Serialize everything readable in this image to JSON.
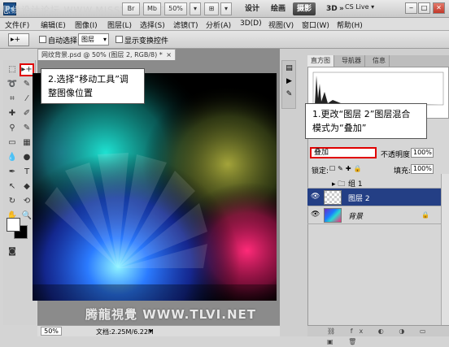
{
  "titlebar": {
    "watermark": "思缘设计论坛 WWW.MISSYUAN.COM",
    "app_logo": "Ps",
    "buttons": [
      "Br",
      "Mb",
      "50%",
      "▾",
      "⊞",
      "▾"
    ],
    "workspaces": [
      {
        "label": "设计",
        "active": false
      },
      {
        "label": "绘画",
        "active": false
      },
      {
        "label": "摄影",
        "active": true
      },
      {
        "label": "3D",
        "active": false
      },
      {
        "label": "»",
        "active": false
      }
    ],
    "cs_live": "CS Live ▾",
    "window_controls": [
      "‒",
      "□",
      "✕"
    ]
  },
  "menubar": [
    "文件(F)",
    "编辑(E)",
    "图像(I)",
    "图层(L)",
    "选择(S)",
    "滤镜(T)",
    "分析(A)",
    "3D(D)",
    "视图(V)",
    "窗口(W)",
    "帮助(H)"
  ],
  "options": {
    "tool_glyph": "▸+",
    "auto_select_label": "自动选择:",
    "auto_select_value": "图层",
    "show_transform_label": "显示变换控件"
  },
  "document": {
    "tab_title": "网纹背景.psd @ 50% (图层 2, RGB/8) *",
    "zoom": "50%",
    "info": "文档:2.25M/6.22M",
    "status_arrow": "▸"
  },
  "footer_watermark": "腾龍視覺 WWW.TLVI.NET",
  "callouts": {
    "move_tool": [
      "2.选择“移动工具”调",
      "整图像位置"
    ],
    "blend_mode": [
      "1.更改“图层 2”图层混合",
      "模式为“叠加”"
    ]
  },
  "panels": {
    "tabs": [
      {
        "label": "直方图",
        "active": true
      },
      {
        "label": "导航器",
        "active": false
      },
      {
        "label": "信息",
        "active": false
      }
    ]
  },
  "layers": {
    "blend_mode": "叠加",
    "opacity_label": "不透明度:",
    "opacity_value": "100%",
    "lock_label": "锁定:",
    "fill_label": "填充:",
    "fill_value": "100%",
    "rows": [
      {
        "name": "组 1",
        "type": "group",
        "visible": false,
        "selected": false
      },
      {
        "name": "图层 2",
        "type": "layer",
        "visible": true,
        "selected": true
      },
      {
        "name": "背景",
        "type": "background",
        "visible": true,
        "selected": false,
        "locked": true
      }
    ],
    "footer_icons": "⛓ fx ◐ ◑ ▭ ▣ 🗑"
  },
  "colors": {
    "highlight": "#e00000",
    "selected_layer": "#243f85"
  }
}
